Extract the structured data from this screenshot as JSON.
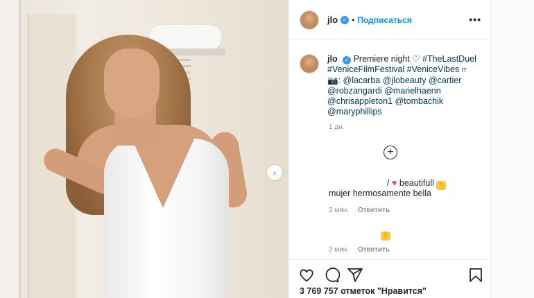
{
  "header": {
    "username": "jlo",
    "separator": "•",
    "follow_label": "Подписаться",
    "more_label": "•••"
  },
  "caption": {
    "username": "jlo",
    "text_start": "Premiere night",
    "heart": "♡",
    "hashtags_line1": "#TheLastDuel",
    "hashtag2": "#VeniceFilmFestival",
    "hashtag3": "#VeniceVibes",
    "mark": "IT",
    "camera": "📷",
    "colon": ":",
    "mentions": [
      "@lacarba",
      "@jlobeauty",
      "@cartier",
      "@robzangardi",
      "@marielhaenn",
      "@chrisappleton1",
      "@tombachik",
      "@maryphillips"
    ],
    "time": "1 дн."
  },
  "load_more_symbol": "+",
  "comments": [
    {
      "line1_prefix": "/",
      "line1_text": "beautifull",
      "line2": "mujer hermosamente bella",
      "time": "2 мин.",
      "reply": "Ответить"
    },
    {
      "emoji": "🙏",
      "time": "2 мин.",
      "reply": "Ответить"
    }
  ],
  "likes_text": "3 769 757 отметок \"Нравится\"",
  "next_arrow": "›"
}
